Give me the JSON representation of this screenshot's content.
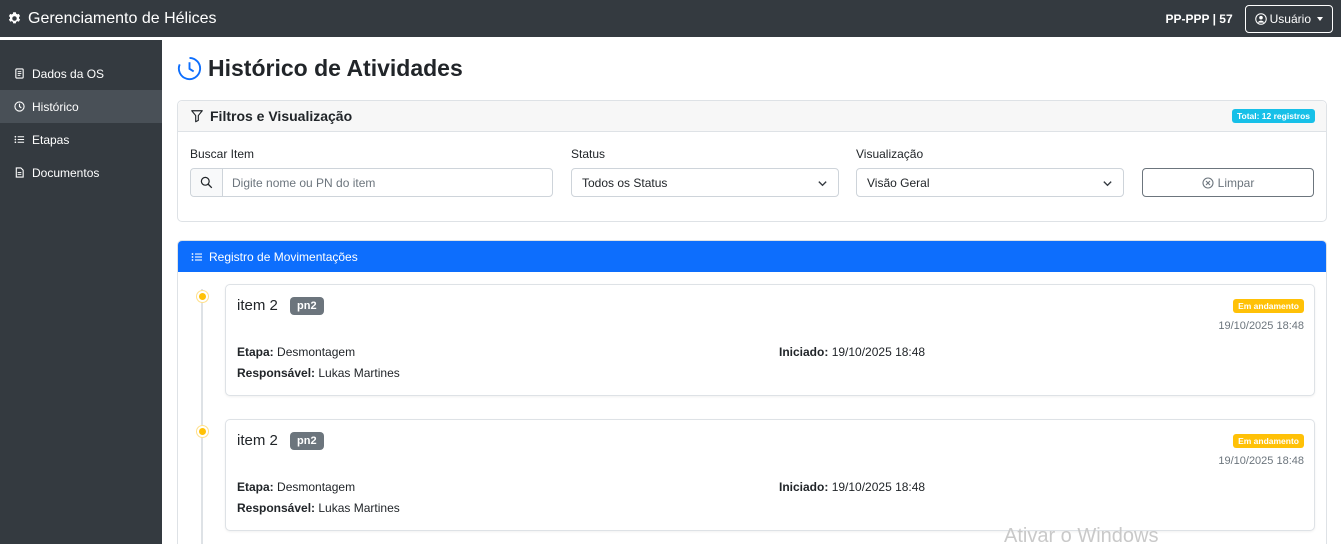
{
  "navbar": {
    "brand": "Gerenciamento de Hélices",
    "os_info": "PP-PPP | 57",
    "user_label": "Usuário"
  },
  "sidebar": {
    "items": [
      {
        "label": "Dados da OS",
        "icon": "document-icon"
      },
      {
        "label": "Histórico",
        "icon": "clock-icon"
      },
      {
        "label": "Etapas",
        "icon": "list-icon"
      },
      {
        "label": "Documentos",
        "icon": "file-text-icon"
      }
    ],
    "active_index": 1
  },
  "page": {
    "title": "Histórico de Atividades"
  },
  "filters": {
    "title": "Filtros e Visualização",
    "total_badge": "Total: 12 registros",
    "search_label": "Buscar Item",
    "search_placeholder": "Digite nome ou PN do item",
    "status_label": "Status",
    "status_value": "Todos os Status",
    "view_label": "Visualização",
    "view_value": "Visão Geral",
    "clear_label": "Limpar"
  },
  "registro": {
    "title": "Registro de Movimentações",
    "entries": [
      {
        "name": "item 2",
        "pn": "pn2",
        "status": "Em andamento",
        "date": "19/10/2025 18:48",
        "etapa_label": "Etapa:",
        "etapa_value": "Desmontagem",
        "iniciado_label": "Iniciado:",
        "iniciado_value": "19/10/2025 18:48",
        "responsavel_label": "Responsável:",
        "responsavel_value": "Lukas Martines"
      },
      {
        "name": "item 2",
        "pn": "pn2",
        "status": "Em andamento",
        "date": "19/10/2025 18:48",
        "etapa_label": "Etapa:",
        "etapa_value": "Desmontagem",
        "iniciado_label": "Iniciado:",
        "iniciado_value": "19/10/2025 18:48",
        "responsavel_label": "Responsável:",
        "responsavel_value": "Lukas Martines"
      }
    ]
  },
  "watermark": "Ativar o Windows",
  "colors": {
    "navbar_bg": "#343a40",
    "primary": "#0d6efd",
    "warning": "#ffc107",
    "info": "#17c0e8",
    "secondary": "#6c757d"
  }
}
